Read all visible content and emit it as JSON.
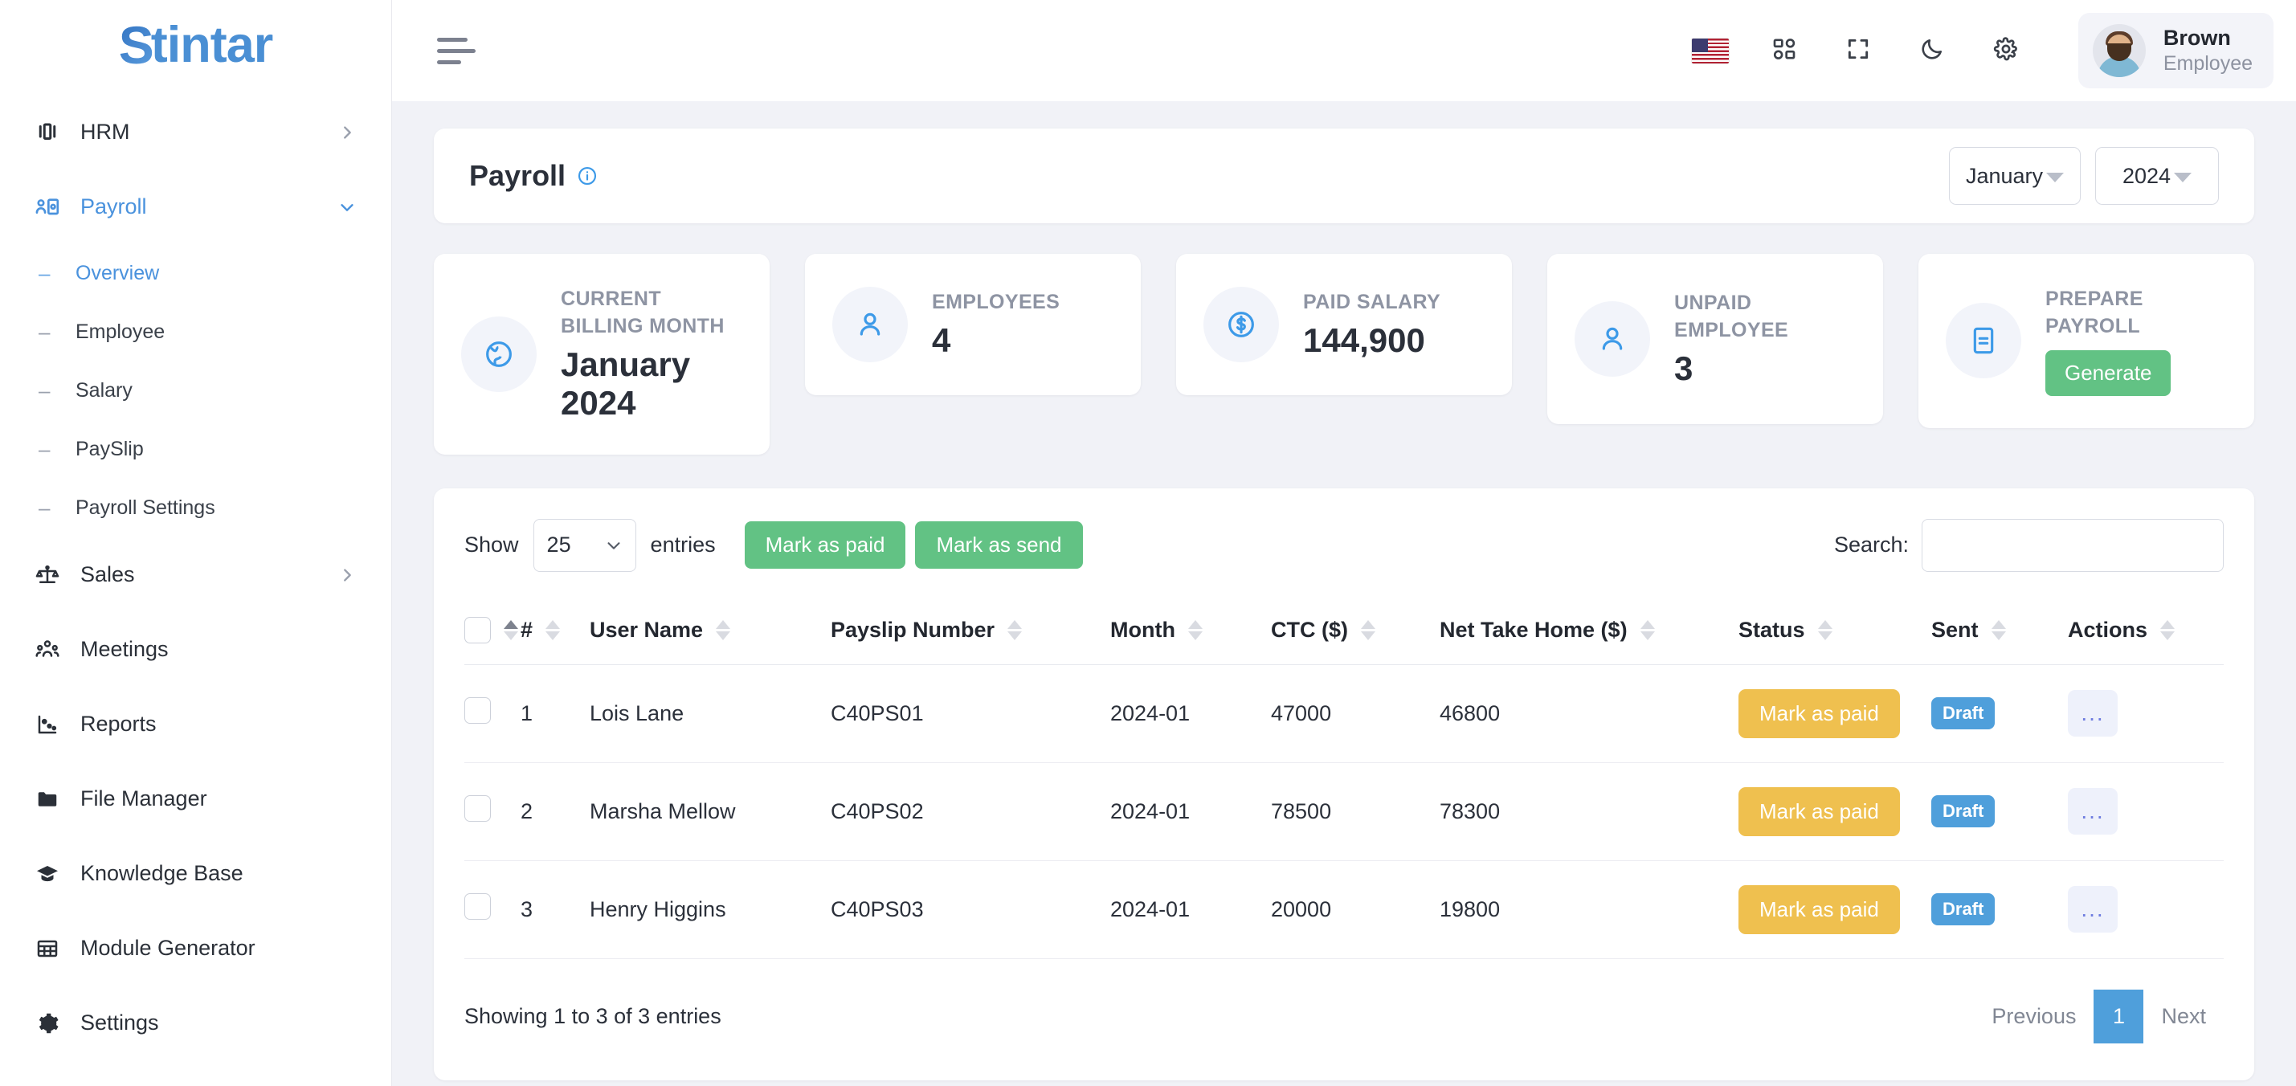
{
  "brand": {
    "name": "Stintar",
    "mark": "S",
    "rest": "tintar",
    "color": "#4a8fd4"
  },
  "sidebar": {
    "items": [
      {
        "label": "HRM",
        "icon": "presentation-icon",
        "type": "parent",
        "expanded": false,
        "active": false
      },
      {
        "label": "Payroll",
        "icon": "payroll-user-money-icon",
        "type": "parent",
        "expanded": true,
        "active": true
      }
    ],
    "payroll_sub": [
      {
        "label": "Overview",
        "active": true
      },
      {
        "label": "Employee",
        "active": false
      },
      {
        "label": "Salary",
        "active": false
      },
      {
        "label": "PaySlip",
        "active": false
      },
      {
        "label": "Payroll Settings",
        "active": false
      }
    ],
    "items_after": [
      {
        "label": "Sales",
        "icon": "scales-balance-icon",
        "type": "parent"
      },
      {
        "label": "Meetings",
        "icon": "people-group-icon",
        "type": "link"
      },
      {
        "label": "Reports",
        "icon": "scatter-chart-icon",
        "type": "link"
      },
      {
        "label": "File Manager",
        "icon": "folder-icon",
        "type": "link"
      },
      {
        "label": "Knowledge Base",
        "icon": "graduation-cap-icon",
        "type": "link"
      },
      {
        "label": "Module Generator",
        "icon": "table-grid-icon",
        "type": "link"
      },
      {
        "label": "Settings",
        "icon": "gear-icon",
        "type": "link"
      }
    ]
  },
  "topbar": {
    "icons": [
      {
        "name": "us-flag-icon"
      },
      {
        "name": "apps-grid-icon"
      },
      {
        "name": "fullscreen-icon"
      },
      {
        "name": "moon-dark-mode-icon"
      },
      {
        "name": "gear-settings-icon"
      }
    ],
    "user": {
      "name": "Brown",
      "role": "Employee"
    }
  },
  "page": {
    "title": "Payroll",
    "month_select": "January",
    "year_select": "2024"
  },
  "stats": [
    {
      "label": "CURRENT BILLING MONTH",
      "value": "January 2024",
      "icon": "globe-icon"
    },
    {
      "label": "EMPLOYEES",
      "value": "4",
      "icon": "user-icon"
    },
    {
      "label": "PAID SALARY",
      "value": "144,900",
      "icon": "dollar-circle-icon"
    },
    {
      "label": "UNPAID EMPLOYEE",
      "value": "3",
      "icon": "user-icon"
    },
    {
      "label": "PREPARE PAYROLL",
      "button": "Generate",
      "icon": "document-icon"
    }
  ],
  "table": {
    "show_label": "Show",
    "entries_label": "entries",
    "page_length": "25",
    "mark_paid_label": "Mark as paid",
    "mark_send_label": "Mark as send",
    "search_label": "Search:",
    "search_value": "",
    "search_placeholder": "",
    "columns": [
      "#",
      "User Name",
      "Payslip Number",
      "Month",
      "CTC ($)",
      "Net Take Home ($)",
      "Status",
      "Sent",
      "Actions"
    ],
    "rows": [
      {
        "num": "1",
        "user": "Lois Lane",
        "payslip": "C40PS01",
        "month": "2024-01",
        "ctc": "47000",
        "net": "46800",
        "status": "Mark as paid",
        "sent": "Draft",
        "action": "..."
      },
      {
        "num": "2",
        "user": "Marsha Mellow",
        "payslip": "C40PS02",
        "month": "2024-01",
        "ctc": "78500",
        "net": "78300",
        "status": "Mark as paid",
        "sent": "Draft",
        "action": "..."
      },
      {
        "num": "3",
        "user": "Henry Higgins",
        "payslip": "C40PS03",
        "month": "2024-01",
        "ctc": "20000",
        "net": "19800",
        "status": "Mark as paid",
        "sent": "Draft",
        "action": "..."
      }
    ],
    "footer_info": "Showing 1 to 3 of 3 entries",
    "pagination": {
      "previous": "Previous",
      "current": "1",
      "next": "Next"
    }
  },
  "colors": {
    "accent_blue": "#4f9fdb",
    "green": "#62c284",
    "yellow": "#efc04f",
    "bg": "#f1f2f7"
  }
}
